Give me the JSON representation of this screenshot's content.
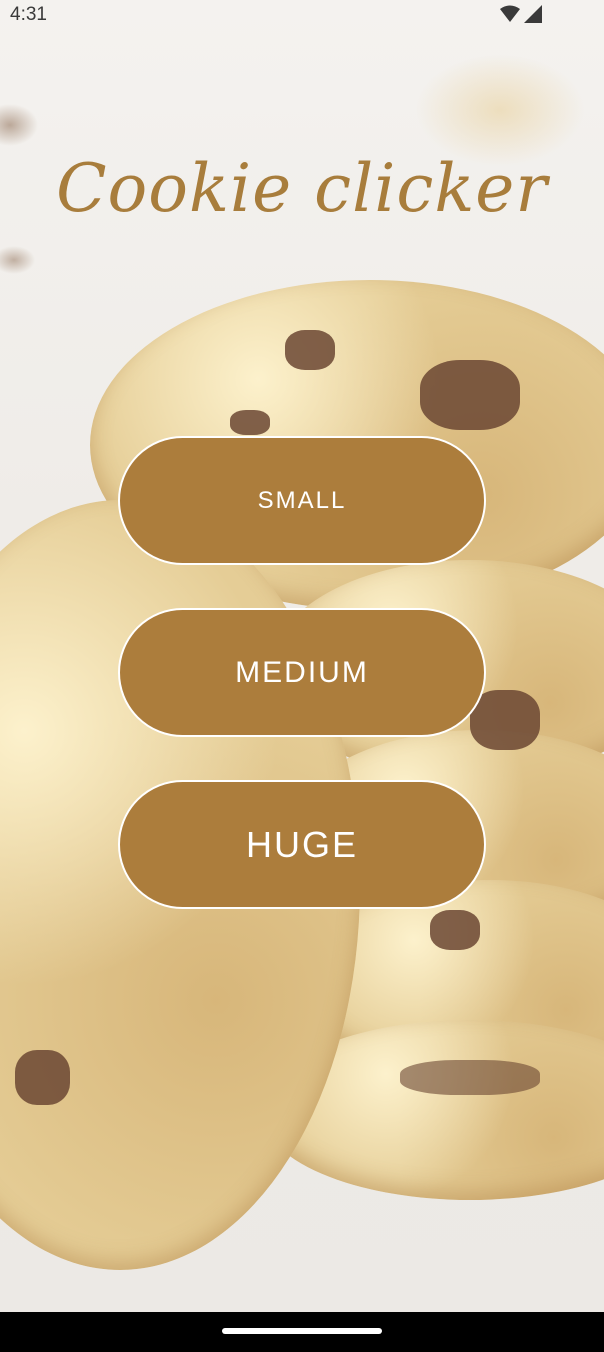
{
  "status_bar": {
    "time": "4:31",
    "icons": [
      "wifi-icon",
      "cellular-signal-icon"
    ]
  },
  "app": {
    "title": "Cookie clicker"
  },
  "buttons": {
    "small_label": "SMALL",
    "medium_label": "MEDIUM",
    "huge_label": "HUGE"
  },
  "colors": {
    "accent": "#ac7d3c",
    "title": "#a87d3c",
    "button_border": "#ffffff",
    "button_text": "#ffffff"
  }
}
